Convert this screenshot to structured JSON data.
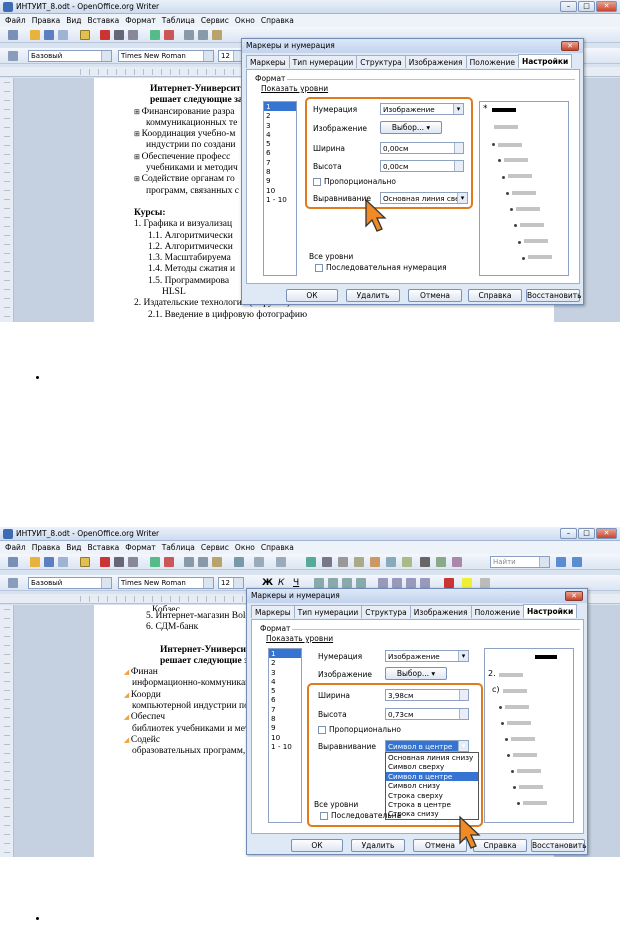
{
  "shot1": {
    "window_title": "ИНТУИТ_8.odt - OpenOffice.org Writer",
    "menu": [
      "Файл",
      "Правка",
      "Вид",
      "Вставка",
      "Формат",
      "Таблица",
      "Сервис",
      "Окно",
      "Справка"
    ],
    "style_value": "Базовый",
    "font_value": "Times New Roman",
    "size_value": "12",
    "doc_lines": [
      {
        "text": "Интернет-Университе",
        "bold": true
      },
      {
        "text": "решает следующие зада",
        "bold": true
      },
      {
        "text": "Финансирование разра",
        "icon": "bullet-image-icon"
      },
      {
        "text": "коммуникационных те"
      },
      {
        "text": "Координация учебно-м",
        "icon": "bullet-image-icon"
      },
      {
        "text": "индустрии по создани"
      },
      {
        "text": "Обеспечение професс",
        "icon": "bullet-image-icon"
      },
      {
        "text": "учебниками и методич"
      },
      {
        "text": "Содействие органам го",
        "icon": "bullet-image-icon"
      },
      {
        "text": "программ, связанных с"
      },
      {
        "text": ""
      },
      {
        "text": "Курсы:",
        "bold": true
      },
      {
        "text": "1.  Графика и визуализац"
      },
      {
        "text": "1.1.  Алгоритмически"
      },
      {
        "text": "1.2.  Алгоритмически"
      },
      {
        "text": "1.3.  Масштабируема"
      },
      {
        "text": "1.4.  Методы сжатия и"
      },
      {
        "text": "1.5.  Программирова"
      },
      {
        "text": "HLSL"
      },
      {
        "text": "2.  Издательские технологии (в группе)"
      },
      {
        "text": "2.1.  Введение в цифровую фотографию"
      }
    ],
    "dialog": {
      "title": "Маркеры и нумерация",
      "tabs": [
        "Маркеры",
        "Тип нумерации",
        "Структура",
        "Изображения",
        "Положение",
        "Настройки"
      ],
      "active_tab": "Настройки",
      "format_label": "Формат",
      "levels_label": "Показать уровни",
      "levels": [
        "1",
        "2",
        "3",
        "4",
        "5",
        "6",
        "7",
        "8",
        "9",
        "10",
        "1 - 10"
      ],
      "numbering_label": "Нумерация",
      "numbering_value": "Изображение",
      "image_label": "Изображение",
      "choose_button": "Выбор...",
      "width_label": "Ширина",
      "width_value": "0,00см",
      "height_label": "Высота",
      "height_value": "0,00см",
      "proportional_label": "Пропорционально",
      "alignment_label": "Выравнивание",
      "alignment_value": "Основная линия свер",
      "all_levels_label": "Все уровни",
      "sequential_label": "Последовательная нумерация",
      "buttons": {
        "ok": "ОК",
        "delete": "Удалить",
        "cancel": "Отмена",
        "help": "Справка",
        "reset": "Восстановить"
      },
      "preview_marker": "*"
    }
  },
  "shot2": {
    "window_title": "ИНТУИТ_8.odt - OpenOffice.org Writer",
    "menu": [
      "Файл",
      "Правка",
      "Вид",
      "Вставка",
      "Формат",
      "Таблица",
      "Сервис",
      "Окно",
      "Справка"
    ],
    "style_value": "Базовый",
    "font_value": "Times New Roman",
    "size_value": "12",
    "find_placeholder": "Найти",
    "format_buttons": {
      "bold": "Ж",
      "italic": "К",
      "underline": "Ч"
    },
    "doc_lines": [
      {
        "text": "Кобзес"
      },
      {
        "text": "5.   Интернет-магазин Bolero"
      },
      {
        "text": "6.   СДМ-банк"
      },
      {
        "text": ""
      },
      {
        "text": "Интернет-Университет",
        "bold": true
      },
      {
        "text": "решает следующие зада",
        "bold": true
      },
      {
        "text": "Финан",
        "logo": true
      },
      {
        "text": "информационно-коммуникац"
      },
      {
        "text": "Коорди",
        "logo": true
      },
      {
        "text": "компьютерной индустрии по"
      },
      {
        "text": "Обеспеч",
        "logo": true
      },
      {
        "text": "библиотек учебниками и мет"
      },
      {
        "text": "Содейс",
        "logo": true
      },
      {
        "text": "образовательных программ,"
      }
    ],
    "logo_text": "ИНТЕРНЕТ УНИВЕРСИТЕТ",
    "dialog": {
      "title": "Маркеры и нумерация",
      "tabs": [
        "Маркеры",
        "Тип нумерации",
        "Структура",
        "Изображения",
        "Положение",
        "Настройки"
      ],
      "active_tab": "Настройки",
      "format_label": "Формат",
      "levels_label": "Показать уровни",
      "levels": [
        "1",
        "2",
        "3",
        "4",
        "5",
        "6",
        "7",
        "8",
        "9",
        "10",
        "1 - 10"
      ],
      "numbering_label": "Нумерация",
      "numbering_value": "Изображение",
      "image_label": "Изображение",
      "choose_button": "Выбор...",
      "width_label": "Ширина",
      "width_value": "3,98см",
      "height_label": "Высота",
      "height_value": "0,73см",
      "proportional_label": "Пропорционально",
      "alignment_label": "Выравнивание",
      "alignment_value": "Символ в центре",
      "alignment_options": [
        "Основная линия снизу",
        "Символ сверху",
        "Символ в центре",
        "Символ снизу",
        "Строка сверху",
        "Строка в центре",
        "Строка снизу"
      ],
      "alignment_selected": "Символ в центре",
      "all_levels_label": "Все уровни",
      "sequential_label": "Последовательна",
      "buttons": {
        "ok": "ОК",
        "delete": "Удалить",
        "cancel": "Отмена",
        "help": "Справка",
        "reset": "Восстановить"
      },
      "preview_labels": [
        "2.",
        "c)"
      ]
    }
  },
  "colors": {
    "highlight": "#e07a1c",
    "selection": "#3574d0",
    "dialog_bg": "#dfe8f5"
  }
}
